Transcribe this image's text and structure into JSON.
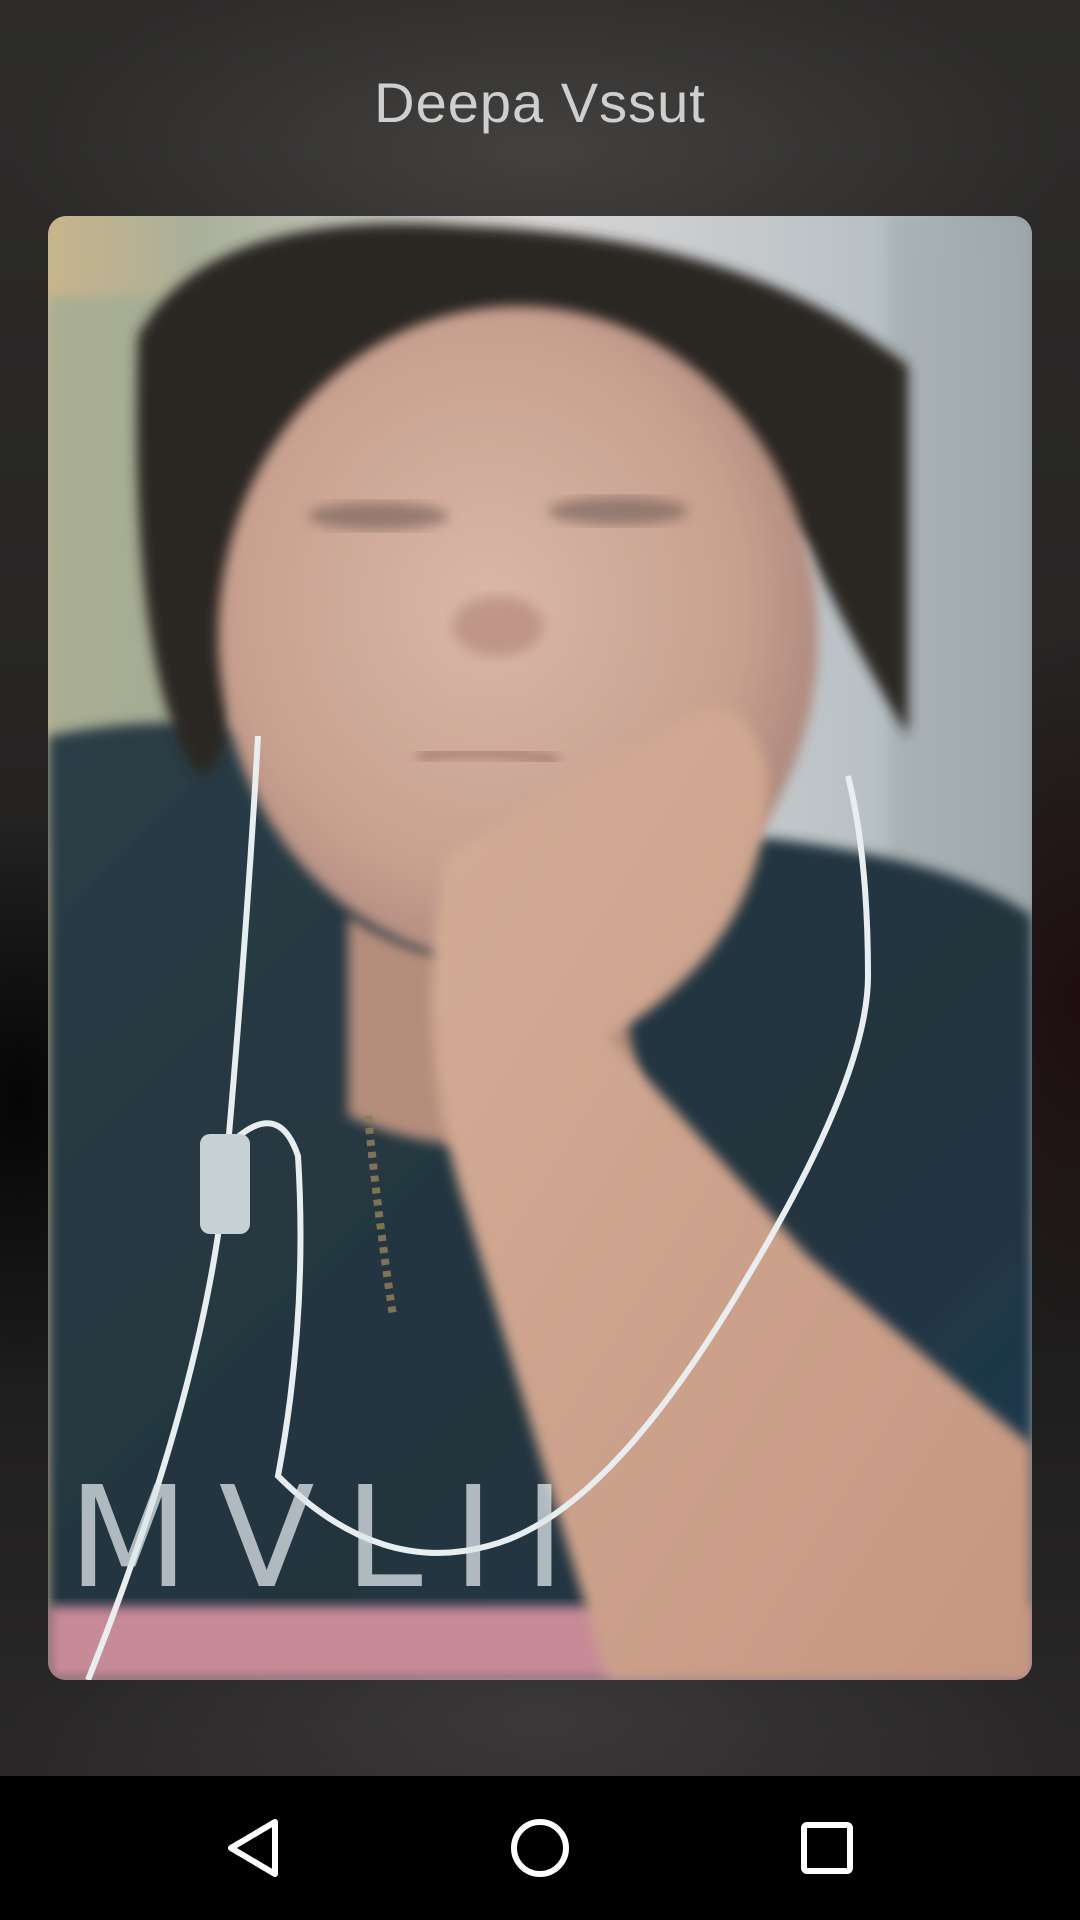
{
  "call": {
    "caller_name": "Deepa Vssut"
  },
  "preview": {
    "shirt_text": "MVLII"
  },
  "nav_bar": {
    "buttons": [
      {
        "name": "back",
        "icon": "back-triangle-icon"
      },
      {
        "name": "home",
        "icon": "home-circle-icon"
      },
      {
        "name": "recents",
        "icon": "recents-square-icon"
      }
    ]
  },
  "colors": {
    "caller_name_text": "#cfcfcf",
    "nav_bar_bg": "#000000",
    "nav_icon": "#ffffff"
  }
}
